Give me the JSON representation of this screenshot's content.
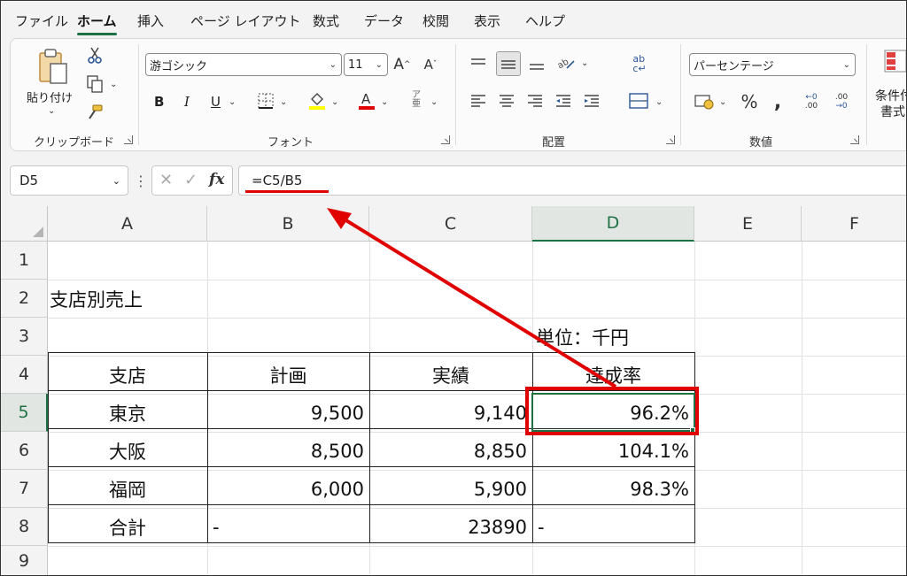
{
  "menu": {
    "tabs": [
      {
        "label": "ファイル"
      },
      {
        "label": "ホーム"
      },
      {
        "label": "挿入"
      },
      {
        "label": "ページ レイアウト"
      },
      {
        "label": "数式"
      },
      {
        "label": "データ"
      },
      {
        "label": "校閲"
      },
      {
        "label": "表示"
      },
      {
        "label": "ヘルプ"
      }
    ],
    "active": "ホーム"
  },
  "ribbon": {
    "clipboard": {
      "label": "クリップボード",
      "paste_label": "貼り付け"
    },
    "font": {
      "label": "フォント",
      "name": "游ゴシック",
      "size": "11",
      "bold": "B",
      "italic": "I",
      "underline": "U"
    },
    "alignment": {
      "label": "配置"
    },
    "number": {
      "label": "数値",
      "format": "パーセンテージ"
    },
    "styles": {
      "conditional_label_1": "条件付",
      "conditional_label_2": "書式"
    },
    "colors": {
      "highlight": "#ffff00",
      "font_color": "#e00000",
      "accent": "#1e7145"
    }
  },
  "formula_bar": {
    "name_box": "D5",
    "formula": "=C5/B5",
    "fx": "fx"
  },
  "sheet": {
    "columns": [
      "A",
      "B",
      "C",
      "D",
      "E",
      "F"
    ],
    "rows": [
      "1",
      "2",
      "3",
      "4",
      "5",
      "6",
      "7",
      "8",
      "9"
    ],
    "selected_cell": "D5",
    "title": "支店別売上",
    "unit": "単位：千円",
    "table": {
      "headers": [
        "支店",
        "計画",
        "実績",
        "達成率"
      ],
      "rows": [
        [
          "東京",
          "9,500",
          "9,140",
          "96.2%"
        ],
        [
          "大阪",
          "8,500",
          "8,850",
          "104.1%"
        ],
        [
          "福岡",
          "6,000",
          "5,900",
          "98.3%"
        ],
        [
          "合計",
          "-",
          "23890",
          "-"
        ]
      ]
    }
  },
  "annotation": {
    "color": "#e00000"
  }
}
